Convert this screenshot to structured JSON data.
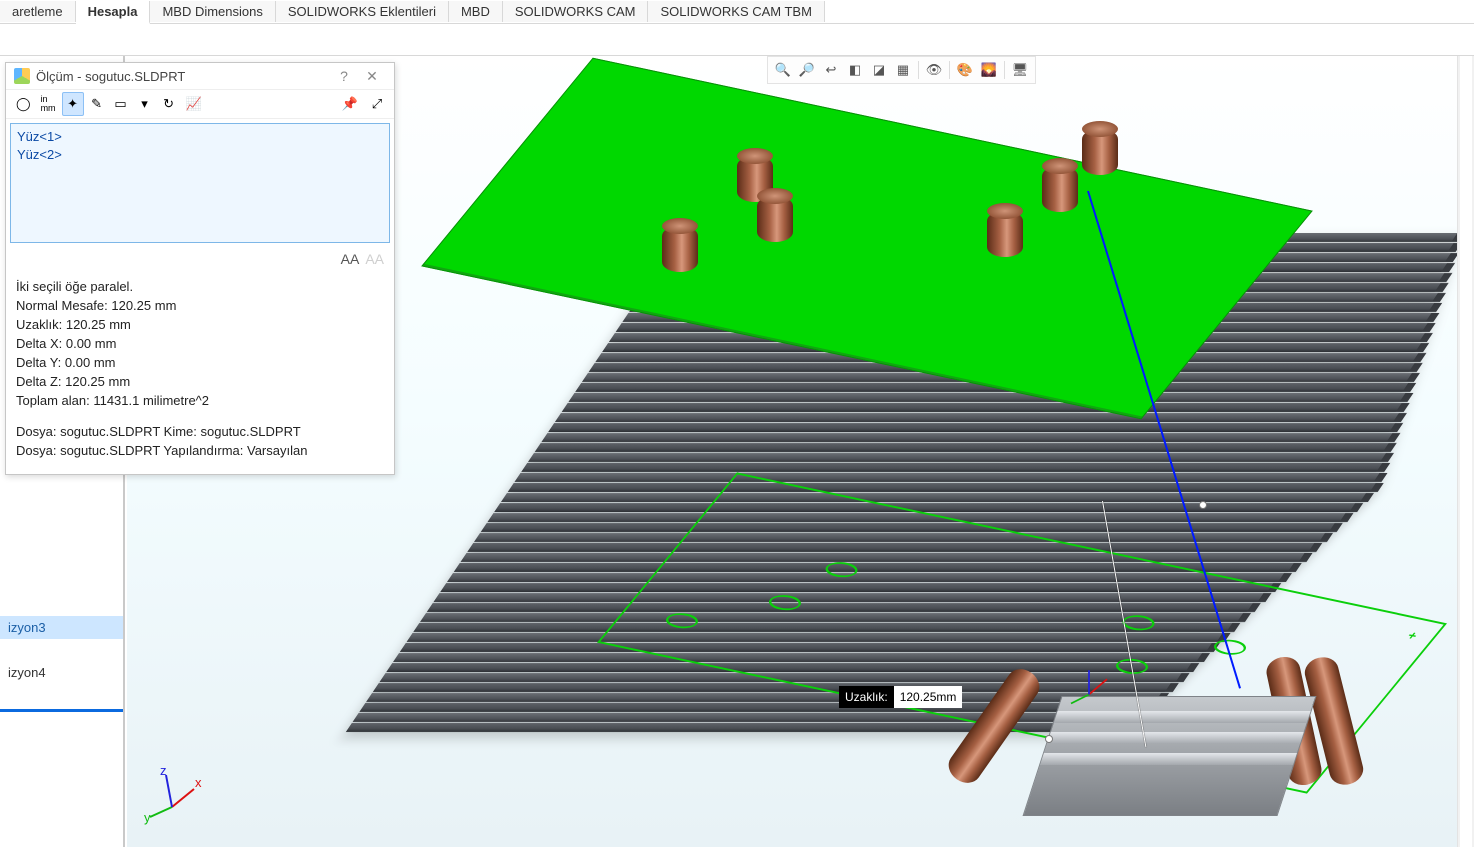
{
  "ribbon_tabs": [
    "aretleme",
    "Hesapla",
    "MBD Dimensions",
    "SOLIDWORKS Eklentileri",
    "MBD",
    "SOLIDWORKS CAM",
    "SOLIDWORKS CAM TBM"
  ],
  "active_tab_index": 1,
  "left_panel": {
    "items": [
      {
        "label": "izyon3",
        "selected": true
      },
      {
        "label": "izyon4",
        "selected": false
      }
    ]
  },
  "hud_icons": [
    "zoom-to-fit-icon",
    "zoom-area-icon",
    "prev-view-icon",
    "section-view-icon",
    "view-orient-icon",
    "display-style-icon",
    "hide-show-icon",
    "edit-appearance-icon",
    "apply-scene-icon",
    "view-settings-icon"
  ],
  "measure_dialog": {
    "title": "Ölçüm - sogutuc.SLDPRT",
    "help": "?",
    "close": "✕",
    "toolbar_icons": [
      "arc-mode-icon",
      "units-icon",
      "xyz-icon",
      "point-icon",
      "projected-icon",
      "dropdown-icon",
      "history-icon",
      "sensor-icon"
    ],
    "units_label": "in\nmm",
    "selection_list": [
      "Yüz<1>",
      "Yüz<2>"
    ],
    "font_buttons": {
      "bigger": "AA",
      "smaller": "AA"
    },
    "results": {
      "parallel": "İki seçili öğe paralel.",
      "normal_distance": "Normal Mesafe: 120.25 mm",
      "distance": "Uzaklık: 120.25 mm",
      "dx": "Delta X: 0.00 mm",
      "dy": "Delta Y: 0.00 mm",
      "dz": "Delta Z: 120.25 mm",
      "total_area": "Toplam alan: 11431.1 milimetre^2",
      "file1": "Dosya: sogutuc.SLDPRT Kime: sogutuc.SLDPRT",
      "file2": "Dosya: sogutuc.SLDPRT Yapılandırma: Varsayılan"
    }
  },
  "annotation": {
    "label": "Uzaklık:",
    "value": "120.25mm"
  },
  "triad_axes": {
    "x": "x",
    "y": "y",
    "z": "z"
  },
  "chart_data": null
}
